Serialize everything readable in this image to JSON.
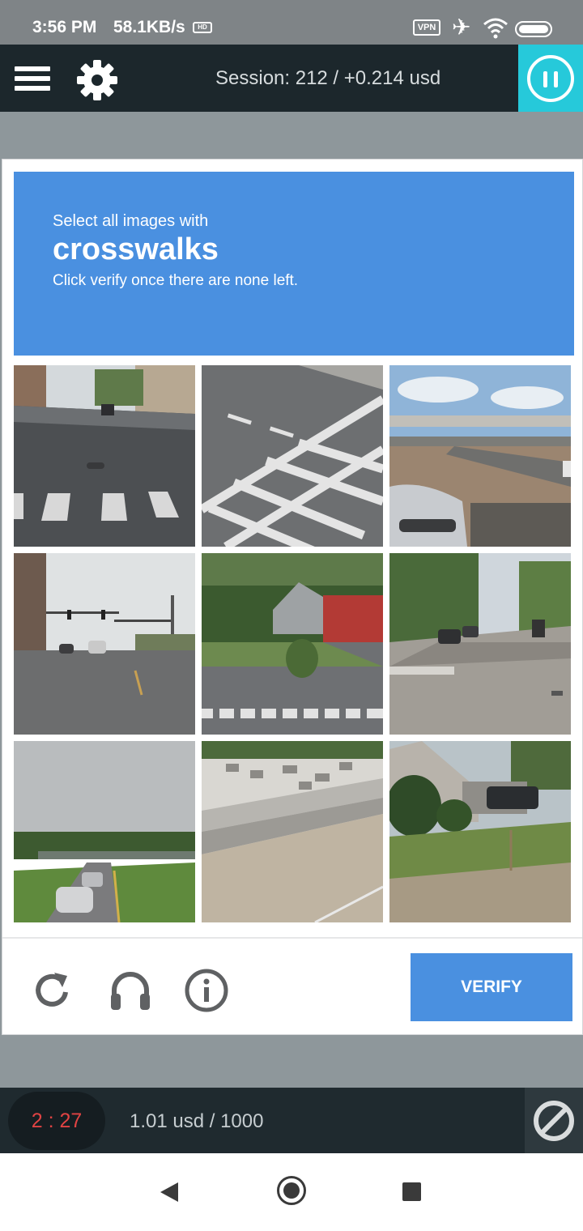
{
  "status_bar": {
    "time": "3:56 PM",
    "net_speed": "58.1KB/s",
    "hd_label": "HD",
    "vpn_label": "VPN",
    "icons": [
      "hd-icon",
      "vpn-icon",
      "airplane-icon",
      "wifi-icon",
      "battery-icon"
    ]
  },
  "header": {
    "session_text": "Session: 212 / +0.214 usd",
    "accent_color": "#26c9da",
    "background_color": "#1c272c",
    "icons": [
      "menu-icon",
      "gear-icon",
      "pause-icon"
    ]
  },
  "captcha": {
    "prompt_line1": "Select all images with",
    "prompt_keyword": "crosswalks",
    "prompt_line3": "Click verify once there are none left.",
    "prompt_color": "#4a90e0",
    "tiles": [
      {
        "scene": "street intersection with crosswalk stripes"
      },
      {
        "scene": "close-up of painted crosswalk stripes on road"
      },
      {
        "scene": "highway overpass with parked car"
      },
      {
        "scene": "wide road with traffic lights"
      },
      {
        "scene": "grey house and red building, crosswalk at bottom"
      },
      {
        "scene": "residential street with parked cars"
      },
      {
        "scene": "highway under overpass with cars"
      },
      {
        "scene": "concrete barrier with parking lot"
      },
      {
        "scene": "house with shrubs and truck"
      }
    ],
    "controls": [
      "reload-icon",
      "headphones-icon",
      "info-icon"
    ],
    "verify_label": "VERIFY"
  },
  "bottom_bar": {
    "timer": "2 : 27",
    "timer_color": "#e04343",
    "earnings": "1.01 usd / 1000",
    "icons": [
      "block-icon"
    ]
  },
  "nav_bar": {
    "icons": [
      "back-icon",
      "home-icon",
      "recents-icon"
    ]
  }
}
